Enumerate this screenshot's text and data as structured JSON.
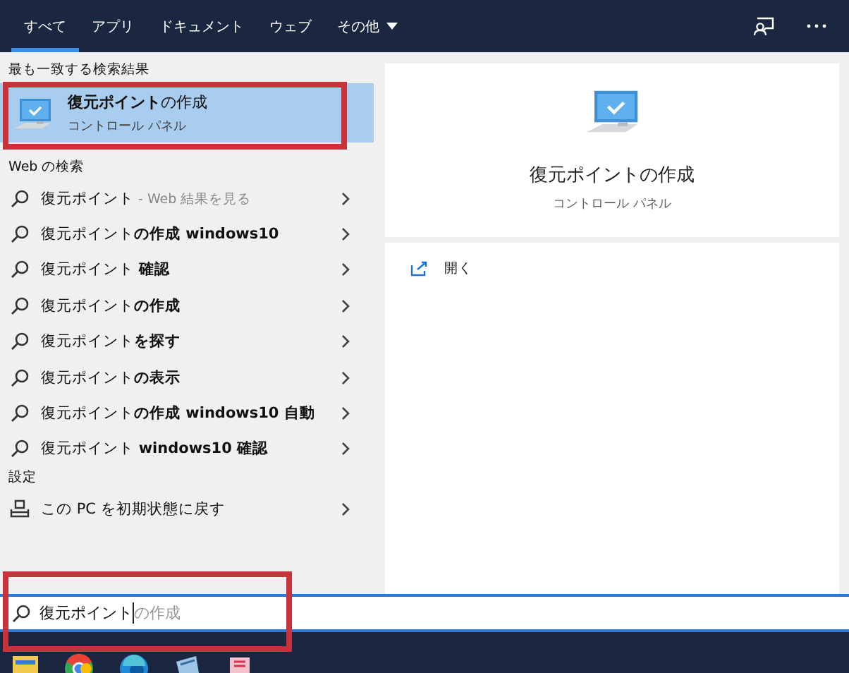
{
  "tabs": [
    {
      "label": "すべて",
      "selected": true
    },
    {
      "label": "アプリ",
      "selected": false
    },
    {
      "label": "ドキュメント",
      "selected": false
    },
    {
      "label": "ウェブ",
      "selected": false
    },
    {
      "label": "その他",
      "selected": false,
      "kind": "menu"
    }
  ],
  "best_match": {
    "heading": "最も一致する検索結果",
    "title": "**復元ポイント**の作成",
    "subtitle": "コントロール パネル",
    "selected": true
  },
  "web": {
    "heading": "Web の検索",
    "items": [
      {
        "text": "復元ポイント",
        "hint": "- Web 結果を見る"
      },
      {
        "text": "復元ポイント**の作成 windows10**"
      },
      {
        "text": "復元ポイント **確認**"
      },
      {
        "text": "復元ポイント**の作成**"
      },
      {
        "text": "復元ポイント**を探す**"
      },
      {
        "text": "復元ポイント**の表示**"
      },
      {
        "text": "復元ポイント**の作成 windows10 自動**"
      },
      {
        "text": "復元ポイント **windows10 確認**"
      }
    ]
  },
  "settings": {
    "heading": "設定",
    "items": [
      {
        "text": "この PC を初期状態に戻す"
      }
    ]
  },
  "preview": {
    "title": "復元ポイントの作成",
    "subtitle": "コントロール パネル",
    "actions": [
      {
        "label": "開く"
      }
    ]
  },
  "search": {
    "value": "復元ポイント",
    "suggestion": "の作成"
  }
}
